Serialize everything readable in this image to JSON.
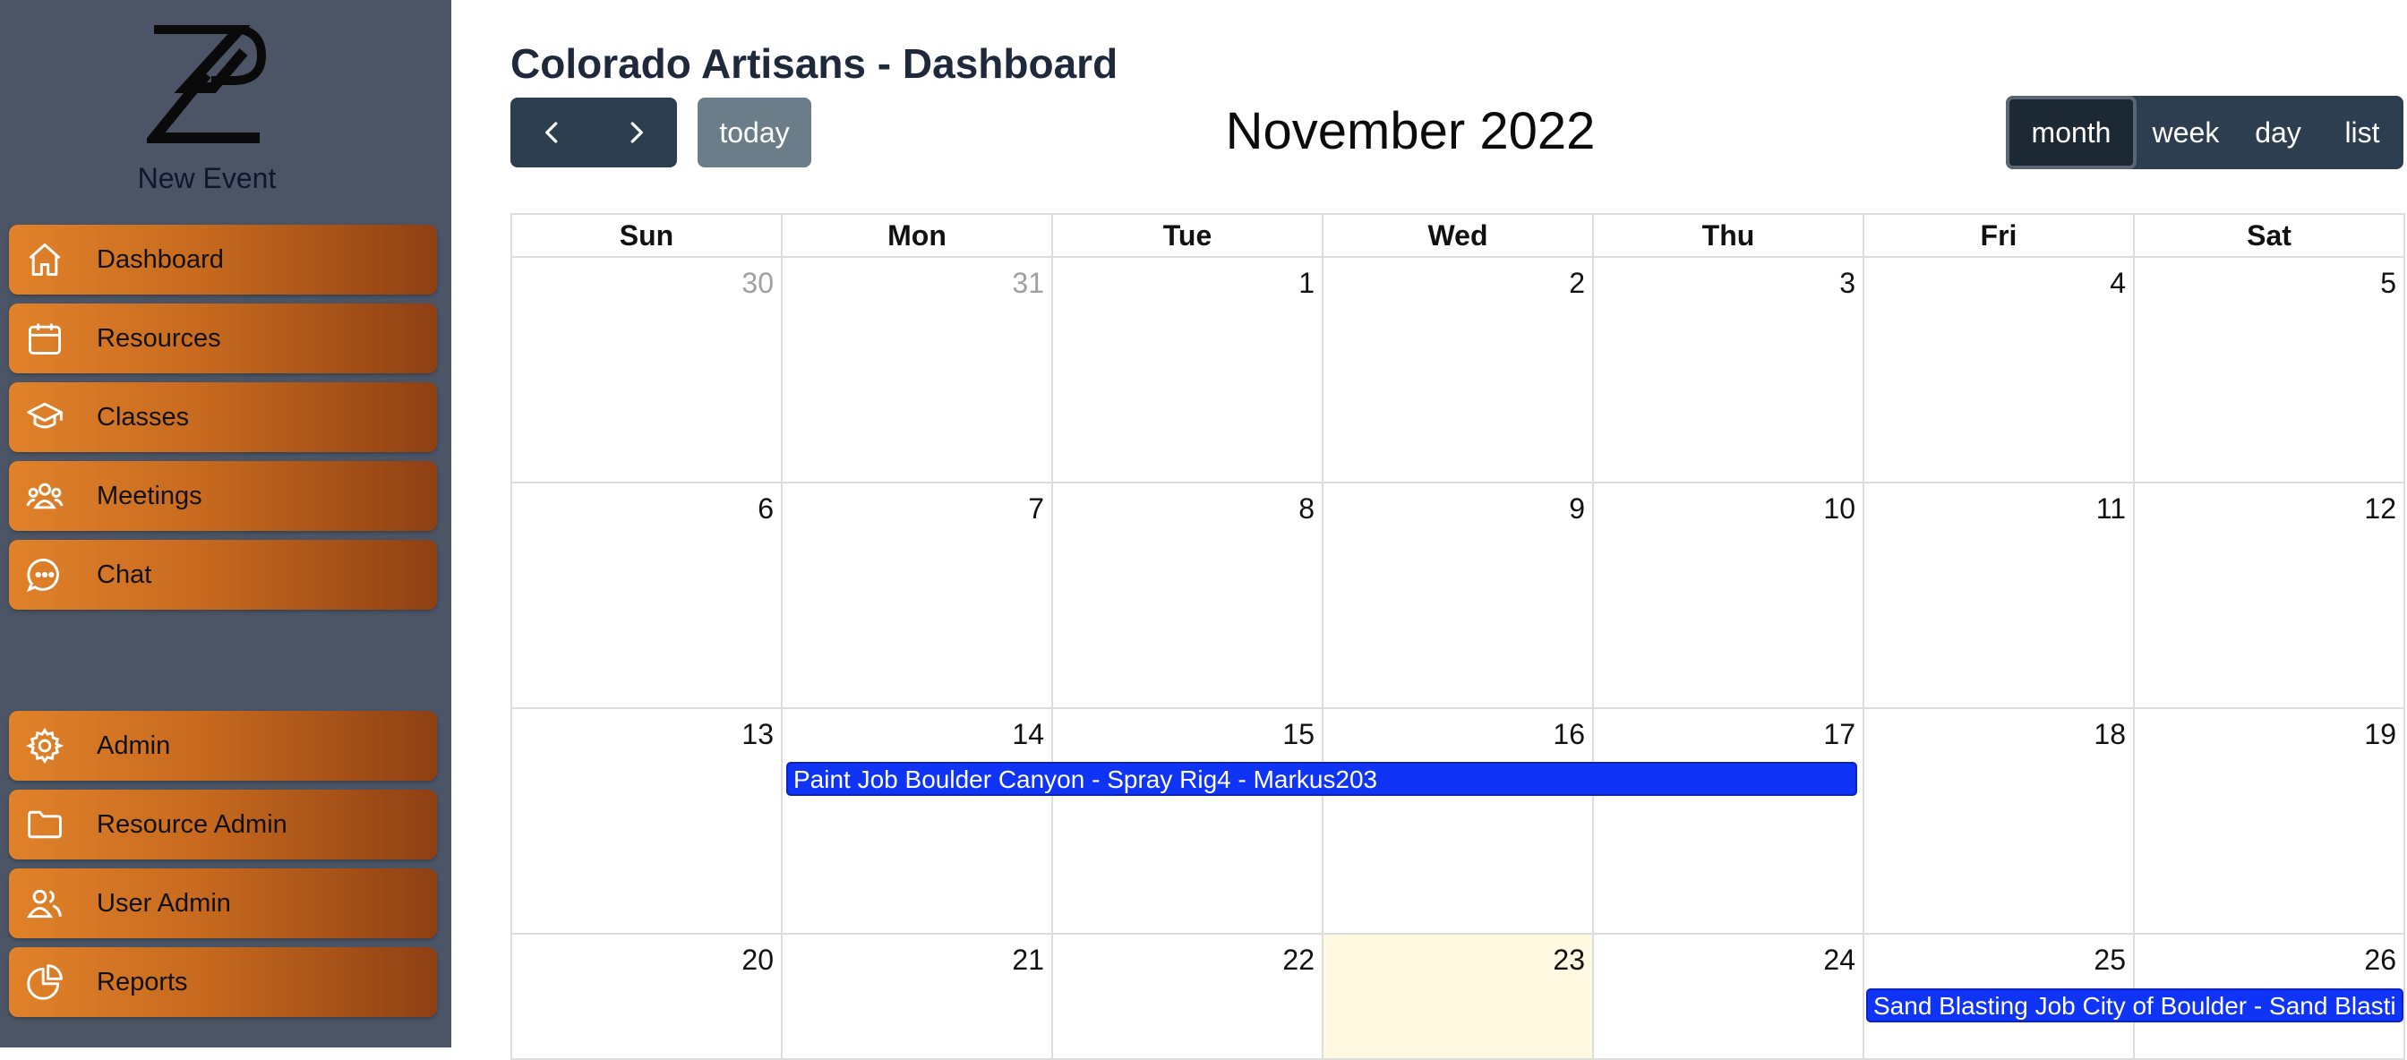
{
  "sidebar": {
    "brand_label": "New Event",
    "items": [
      {
        "label": "Dashboard",
        "icon": "home-icon"
      },
      {
        "label": "Resources",
        "icon": "calendar-icon"
      },
      {
        "label": "Classes",
        "icon": "graduation-cap-icon"
      },
      {
        "label": "Meetings",
        "icon": "users-group-icon"
      },
      {
        "label": "Chat",
        "icon": "chat-bubble-icon"
      },
      {
        "label": "Admin",
        "icon": "gear-icon"
      },
      {
        "label": "Resource Admin",
        "icon": "folder-icon"
      },
      {
        "label": "User Admin",
        "icon": "users-icon"
      },
      {
        "label": "Reports",
        "icon": "pie-chart-icon"
      }
    ]
  },
  "header": {
    "title": "Colorado Artisans - Dashboard",
    "today_label": "today",
    "calendar_title": "November 2022",
    "views": [
      "month",
      "week",
      "day",
      "list"
    ],
    "active_view": "month"
  },
  "calendar": {
    "weekdays": [
      "Sun",
      "Mon",
      "Tue",
      "Wed",
      "Thu",
      "Fri",
      "Sat"
    ],
    "weeks": [
      [
        "30",
        "31",
        "1",
        "2",
        "3",
        "4",
        "5"
      ],
      [
        "6",
        "7",
        "8",
        "9",
        "10",
        "11",
        "12"
      ],
      [
        "13",
        "14",
        "15",
        "16",
        "17",
        "18",
        "19"
      ],
      [
        "20",
        "21",
        "22",
        "23",
        "24",
        "25",
        "26"
      ]
    ],
    "today_date": "23",
    "events": [
      {
        "title": "Paint Job Boulder Canyon - Spray Rig4 - Markus203",
        "start": "14",
        "end": "17",
        "color": "#1034f5"
      },
      {
        "title": "Sand Blasting Job City of Boulder - Sand Blasti",
        "start": "25",
        "end": "26",
        "color": "#1034f5"
      }
    ]
  },
  "colors": {
    "sidebar_bg": "#4b5565",
    "nav_gradient_start": "#e1822a",
    "nav_gradient_end": "#8e4013",
    "button_dark": "#2c3e50",
    "button_today": "#6c7d8a",
    "event_blue": "#1034f5",
    "today_bg": "#fef9e0"
  }
}
